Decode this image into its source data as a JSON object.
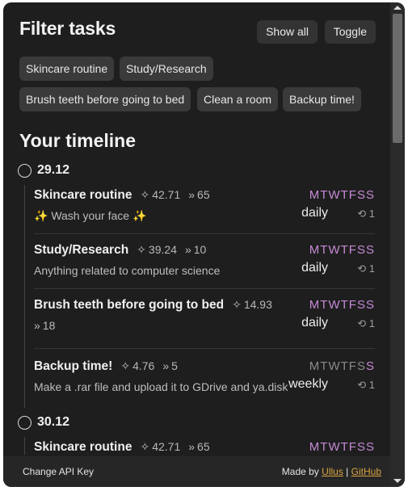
{
  "header": {
    "title": "Filter tasks",
    "show_all_label": "Show all",
    "toggle_label": "Toggle"
  },
  "filters": [
    "Skincare routine",
    "Study/Research",
    "Brush teeth before going to bed",
    "Clean a room",
    "Backup time!"
  ],
  "timeline": {
    "title": "Your timeline",
    "week_letters": [
      "M",
      "T",
      "W",
      "T",
      "F",
      "S",
      "S"
    ],
    "days": [
      {
        "date": "29.12",
        "tasks": [
          {
            "name": "Skincare routine",
            "score": "42.71",
            "streak": "65",
            "description": "✨ Wash your face ✨",
            "active_days": [
              true,
              true,
              true,
              true,
              true,
              true,
              true
            ],
            "frequency": "daily",
            "repeat": "1"
          },
          {
            "name": "Study/Research",
            "score": "39.24",
            "streak": "10",
            "description": "Anything related to computer science",
            "active_days": [
              true,
              true,
              true,
              true,
              true,
              true,
              true
            ],
            "frequency": "daily",
            "repeat": "1"
          },
          {
            "name": "Brush teeth before going to bed",
            "score": "14.93",
            "streak": "18",
            "description": "",
            "active_days": [
              true,
              true,
              true,
              true,
              true,
              true,
              true
            ],
            "frequency": "daily",
            "repeat": "1"
          },
          {
            "name": "Backup time!",
            "score": "4.76",
            "streak": "5",
            "description": "Make a .rar file and upload it to GDrive and ya.disk",
            "active_days": [
              false,
              false,
              false,
              false,
              false,
              false,
              true
            ],
            "frequency": "weekly",
            "repeat": "1"
          }
        ]
      },
      {
        "date": "30.12",
        "tasks": [
          {
            "name": "Skincare routine",
            "score": "42.71",
            "streak": "65",
            "description": "",
            "active_days": [
              true,
              true,
              true,
              true,
              true,
              true,
              true
            ],
            "frequency": "",
            "repeat": ""
          }
        ]
      }
    ]
  },
  "footer": {
    "change_api_key": "Change API Key",
    "made_by": "Made by",
    "author": "Ullus",
    "separator": "|",
    "github": "GitHub"
  },
  "colors": {
    "background": "#1e1e1e",
    "chip": "#3a3a3a",
    "active_day": "#c58ad6",
    "inactive_day": "#8a8a8a",
    "link": "#d9a441"
  },
  "icons": {
    "score": "sparkle-icon",
    "streak": "fast-forward-icon",
    "repeat": "repeat-icon"
  }
}
